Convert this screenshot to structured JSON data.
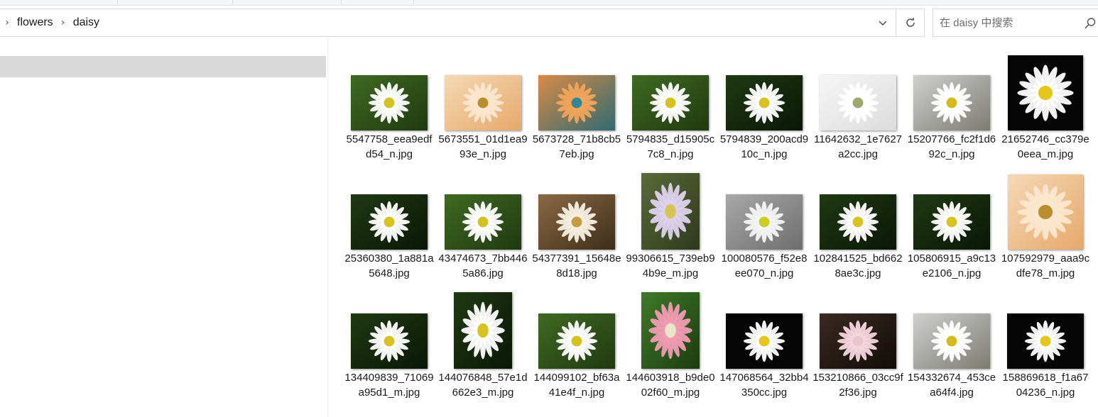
{
  "breadcrumb": {
    "items": [
      "flowers",
      "daisy"
    ]
  },
  "search": {
    "placeholder": "在 daisy 中搜索"
  },
  "colors": {
    "selection": "#d9d9d9",
    "border": "#d9d9d9",
    "text": "#1a1a1a"
  },
  "icons": {
    "chevron": "chevron-right-icon",
    "dropdown": "chevron-down-icon",
    "refresh": "refresh-icon",
    "search": "search-icon"
  },
  "files": [
    {
      "name": "5547758_eea9edfd54_n.jpg",
      "style": "green",
      "shape": "land"
    },
    {
      "name": "5673551_01d1ea993e_n.jpg",
      "style": "peach",
      "shape": "land"
    },
    {
      "name": "5673728_71b8cb57eb.jpg",
      "style": "teal",
      "shape": "land"
    },
    {
      "name": "5794835_d15905c7c8_n.jpg",
      "style": "green",
      "shape": "land"
    },
    {
      "name": "5794839_200acd910c_n.jpg",
      "style": "dark",
      "shape": "land"
    },
    {
      "name": "11642632_1e7627a2cc.jpg",
      "style": "white",
      "shape": "land"
    },
    {
      "name": "15207766_fc2f1d692c_n.jpg",
      "style": "light",
      "shape": "land"
    },
    {
      "name": "21652746_cc379e0eea_m.jpg",
      "style": "black",
      "shape": "square"
    },
    {
      "name": "25360380_1a881a5648.jpg",
      "style": "dark",
      "shape": "land"
    },
    {
      "name": "43474673_7bb4465a86.jpg",
      "style": "green",
      "shape": "land"
    },
    {
      "name": "54377391_15648e8d18.jpg",
      "style": "brown",
      "shape": "land"
    },
    {
      "name": "99306615_739eb94b9e_m.jpg",
      "style": "lilac",
      "shape": "tall"
    },
    {
      "name": "100080576_f52e8ee070_n.jpg",
      "style": "grey",
      "shape": "land"
    },
    {
      "name": "102841525_bd6628ae3c.jpg",
      "style": "dark",
      "shape": "land"
    },
    {
      "name": "105806915_a9c13e2106_n.jpg",
      "style": "dark",
      "shape": "land"
    },
    {
      "name": "107592979_aaa9cdfe78_m.jpg",
      "style": "peach",
      "shape": "square"
    },
    {
      "name": "134409839_71069a95d1_m.jpg",
      "style": "dark",
      "shape": "land"
    },
    {
      "name": "144076848_57e1d662e3_m.jpg",
      "style": "dark",
      "shape": "tall"
    },
    {
      "name": "144099102_bf63a41e4f_n.jpg",
      "style": "green",
      "shape": "land"
    },
    {
      "name": "144603918_b9de002f60_m.jpg",
      "style": "pink",
      "shape": "tall"
    },
    {
      "name": "147068564_32bb4350cc.jpg",
      "style": "black",
      "shape": "land"
    },
    {
      "name": "153210866_03cc9f2f36.jpg",
      "style": "pinkdark",
      "shape": "land"
    },
    {
      "name": "154332674_453cea64f4.jpg",
      "style": "light",
      "shape": "land"
    },
    {
      "name": "158869618_f1a6704236_n.jpg",
      "style": "black",
      "shape": "land"
    }
  ]
}
